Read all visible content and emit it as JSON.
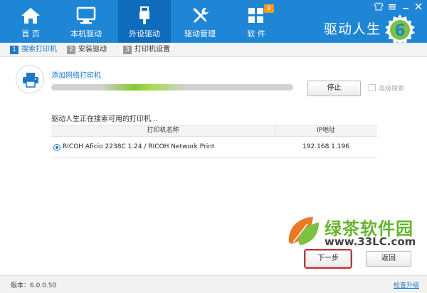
{
  "nav": {
    "items": [
      {
        "label": "首 页",
        "icon": "home-icon"
      },
      {
        "label": "本机驱动",
        "icon": "monitor-icon"
      },
      {
        "label": "外设驱动",
        "icon": "usb-icon",
        "active": true
      },
      {
        "label": "驱动管理",
        "icon": "tools-icon"
      },
      {
        "label": "软 件",
        "icon": "grid-icon",
        "badge": "9"
      }
    ],
    "brand": "驱动人生",
    "brand_logo_digit": "6"
  },
  "steps": [
    {
      "num": "1",
      "label": "搜索打印机",
      "active": true
    },
    {
      "num": "2",
      "label": "安装驱动"
    },
    {
      "num": "3",
      "label": "打印机设置"
    }
  ],
  "search": {
    "add_network_printer": "添加网络打印机",
    "progress_fraction": 0.15,
    "stop_label": "停止",
    "advanced_label": "高级搜索",
    "status_text": "驱动人生正在搜索可用的打印机..."
  },
  "table": {
    "headers": [
      "打印机名称",
      "IP地址"
    ],
    "rows": [
      {
        "name": "RICOH Aficio 2238C 1.24 / RICOH Network Print",
        "ip": "192.168.1.196",
        "selected": true
      }
    ]
  },
  "watermark": {
    "title": "绿茶软件园",
    "url": "www.33LC.com"
  },
  "actions": {
    "next_label": "下一步",
    "back_label": "返回"
  },
  "footer": {
    "version": "版本：6.0.0.50",
    "check_update": "检查升级"
  },
  "colors": {
    "topbar": "#1f86d5",
    "topbar_active": "#0f6cbd",
    "accent": "#1b78cb",
    "progress": "#86c835",
    "watermark_green": "#66b42f",
    "next_highlight": "#c8323a"
  }
}
